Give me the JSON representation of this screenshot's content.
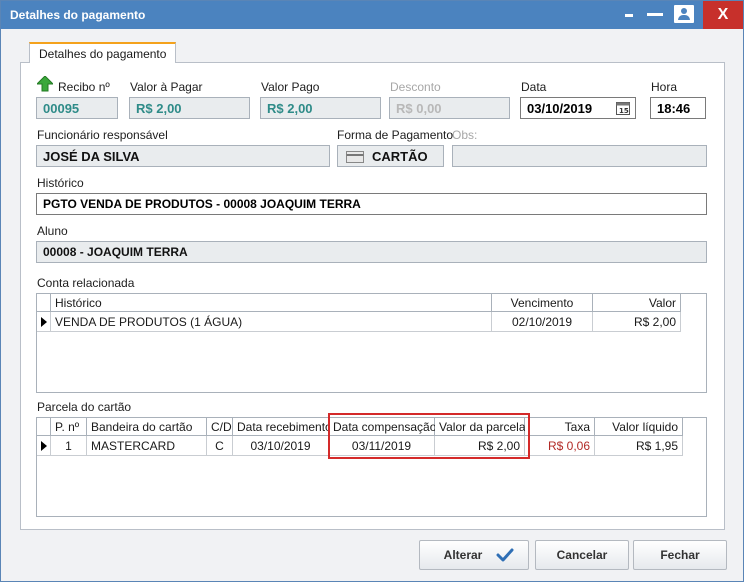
{
  "window": {
    "title": "Detalhes do pagamento",
    "close_label": "X"
  },
  "tab": {
    "label": "Detalhes do pagamento"
  },
  "fields": {
    "recibo": {
      "label": "Recibo nº",
      "value": "00095"
    },
    "valor_pagar": {
      "label": "Valor à Pagar",
      "value": "R$ 2,00"
    },
    "valor_pago": {
      "label": "Valor Pago",
      "value": "R$ 2,00"
    },
    "desconto": {
      "label": "Desconto",
      "value": "R$ 0,00"
    },
    "data": {
      "label": "Data",
      "value": "03/10/2019"
    },
    "hora": {
      "label": "Hora",
      "value": "18:46"
    },
    "funcionario": {
      "label": "Funcionário responsável",
      "value": "JOSÉ DA SILVA"
    },
    "forma_pagamento": {
      "label": "Forma de Pagamento",
      "value": "CARTÃO"
    },
    "obs": {
      "label": "Obs:",
      "value": ""
    },
    "historico": {
      "label": "Histórico",
      "value": "PGTO VENDA DE PRODUTOS - 00008 JOAQUIM TERRA"
    },
    "aluno": {
      "label": "Aluno",
      "value": "00008 - JOAQUIM TERRA"
    }
  },
  "conta": {
    "label": "Conta relacionada",
    "columns": [
      "Histórico",
      "Vencimento",
      "Valor"
    ],
    "rows": [
      [
        "VENDA DE PRODUTOS (1 ÁGUA)",
        "02/10/2019",
        "R$ 2,00"
      ]
    ]
  },
  "parcela": {
    "label": "Parcela do cartão",
    "columns": [
      "P. nº",
      "Bandeira do cartão",
      "C/D",
      "Data recebimento",
      "Data compensação",
      "Valor da parcela",
      "Taxa",
      "Valor líquido"
    ],
    "rows": [
      [
        "1",
        "MASTERCARD",
        "C",
        "03/10/2019",
        "03/11/2019",
        "R$ 2,00",
        "R$ 0,06",
        "R$ 1,95"
      ]
    ],
    "highlight_color": "#d42a2a"
  },
  "buttons": {
    "alterar": "Alterar",
    "cancelar": "Cancelar",
    "fechar": "Fechar"
  },
  "colors": {
    "titlebar": "#4b83bf",
    "close": "#c7302b",
    "tab_accent": "#f4a21c",
    "teal_text": "#2e8b88",
    "fee_red": "#b22a26"
  },
  "icons": {
    "recibo": "green-up-arrow-icon",
    "card": "card-icon",
    "calendar": "calendar-icon",
    "confirm": "check-icon",
    "user": "user-card-icon"
  }
}
